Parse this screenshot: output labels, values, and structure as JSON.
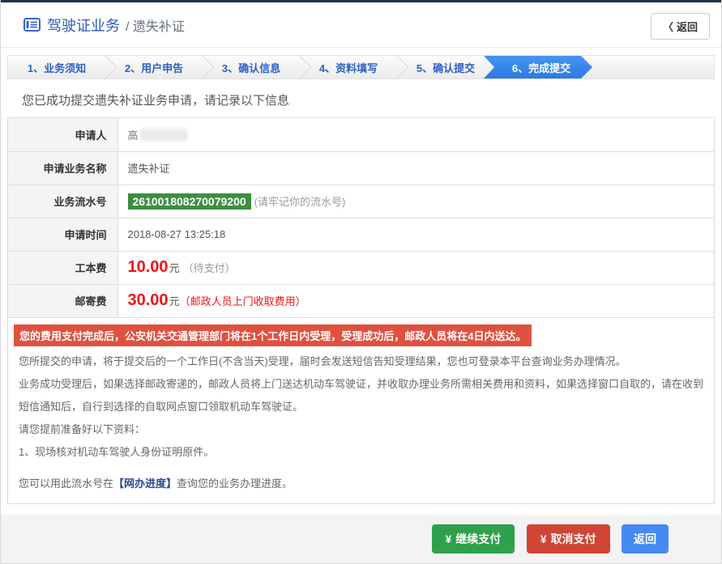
{
  "header": {
    "title": "驾驶证业务",
    "subtitle": "/ 遗失补证",
    "back_chevron": "〈",
    "back_label": "返回"
  },
  "steps": [
    {
      "label": "1、业务须知",
      "active": false
    },
    {
      "label": "2、用户申告",
      "active": false
    },
    {
      "label": "3、确认信息",
      "active": false
    },
    {
      "label": "4、资料填写",
      "active": false
    },
    {
      "label": "5、确认提交",
      "active": false
    },
    {
      "label": "6、完成提交",
      "active": true
    }
  ],
  "success_message": "您已成功提交遗失补证业务申请，请记录以下信息",
  "info": {
    "applicant": {
      "label": "申请人",
      "value": "高"
    },
    "service": {
      "label": "申请业务名称",
      "value": "遗失补证"
    },
    "serial": {
      "label": "业务流水号",
      "value": "261001808270079200",
      "note": "(请牢记你的流水号)"
    },
    "time": {
      "label": "申请时间",
      "value": "2018-08-27 13:25:18"
    },
    "fee": {
      "label": "工本费",
      "amount": "10.00",
      "unit": "元",
      "note": "（待支付）"
    },
    "postage": {
      "label": "邮寄费",
      "amount": "30.00",
      "unit": "元",
      "note": "（邮政人员上门收取费用）"
    }
  },
  "alert": "您的费用支付完成后，公安机关交通管理部门将在1个工作日内受理，受理成功后，邮政人员将在4日内送达。",
  "paragraphs": [
    "您所提交的申请，将于提交后的一个工作日(不含当天)受理，届时会发送短信告知受理结果，您也可登录本平台查询业务办理情况。",
    "业务成功受理后，如果选择邮政寄递的，邮政人员将上门送达机动车驾驶证，并收取办理业务所需相关费用和资料，如果选择窗口自取的，请在收到短信通知后，自行到选择的自取网点窗口领取机动车驾驶证。",
    "请您提前准备好以下资料：",
    "1、现场核对机动车驾驶人身份证明原件。"
  ],
  "query_line": {
    "prefix": "您可以用此流水号在",
    "link": "【网办进度】",
    "suffix": "查询您的业务办理进度。"
  },
  "footer": {
    "continue_pay": {
      "icon": "¥",
      "label": "继续支付"
    },
    "cancel_pay": {
      "icon": "¥",
      "label": "取消支付"
    },
    "back": {
      "label": "返回"
    }
  },
  "colors": {
    "top_bar": "#20304e",
    "title_blue": "#2f5bb7",
    "step_active_blue": "#2f7ee6",
    "serial_green": "#3e8e41",
    "alert_red": "#e0503f",
    "price_red": "#f21212",
    "button_green": "#2fa04c",
    "button_red": "#d04436",
    "button_blue": "#4689f2"
  }
}
